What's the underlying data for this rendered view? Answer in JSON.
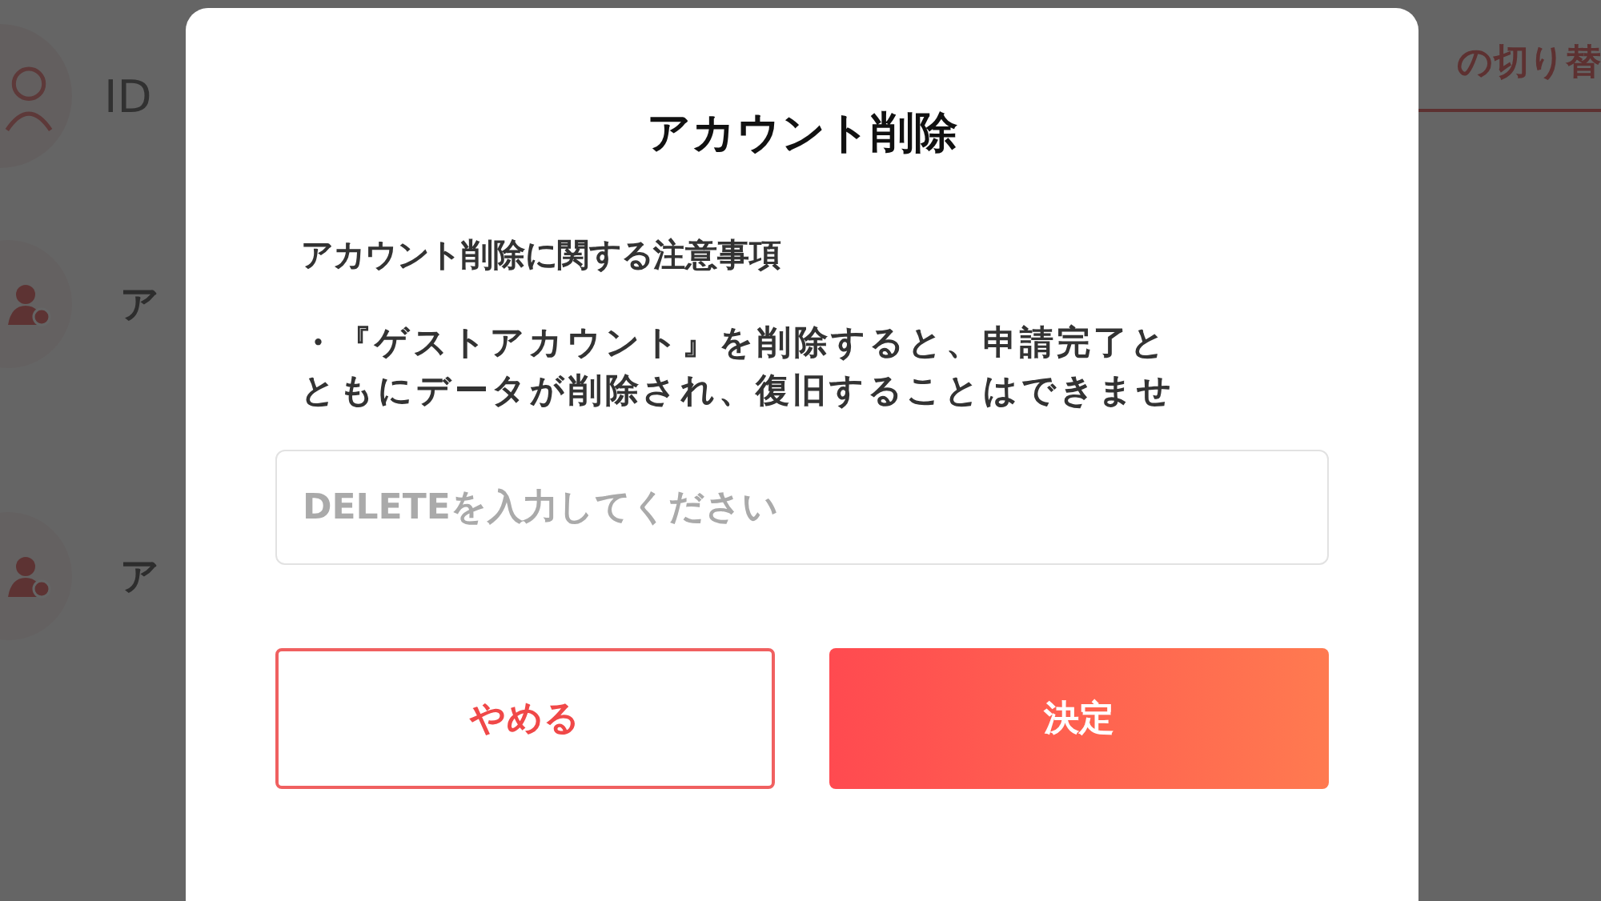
{
  "background": {
    "user_id": "ID",
    "switch_button": "の切り替",
    "menu_items": [
      {
        "label": "ア"
      },
      {
        "label": "ア"
      }
    ]
  },
  "dialog": {
    "title": "アカウント削除",
    "notice_heading": "アカウント削除に関する注意事項",
    "notice_text": "・『ゲストアカウント』を削除すると、申請完了とともにデータが削除され、復旧することはできませ",
    "input": {
      "placeholder": "DELETEを入力してください"
    },
    "buttons": [
      {
        "label": "やめる",
        "kind": "cancel"
      },
      {
        "label": "決定",
        "kind": "confirm"
      }
    ]
  }
}
